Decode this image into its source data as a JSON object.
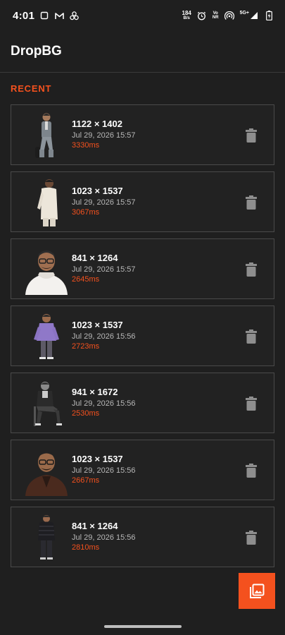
{
  "status_bar": {
    "time": "4:01",
    "icons_left": [
      "screen-icon",
      "gmail-icon",
      "apps-icon"
    ],
    "data_rate": "184",
    "data_unit": "B/s",
    "volte_line1": "Vo",
    "volte_line2": "NR",
    "network": "5G+"
  },
  "app": {
    "title": "DropBG"
  },
  "section": {
    "label": "RECENT"
  },
  "items": [
    {
      "dims": "1122 × 1402",
      "date": "Jul 29, 2026  15:57",
      "duration": "3330ms"
    },
    {
      "dims": "1023 × 1537",
      "date": "Jul 29, 2026  15:57",
      "duration": "3067ms"
    },
    {
      "dims": "841 × 1264",
      "date": "Jul 29, 2026  15:57",
      "duration": "2645ms"
    },
    {
      "dims": "1023 × 1537",
      "date": "Jul 29, 2026  15:56",
      "duration": "2723ms"
    },
    {
      "dims": "941 × 1672",
      "date": "Jul 29, 2026  15:56",
      "duration": "2530ms"
    },
    {
      "dims": "1023 × 1537",
      "date": "Jul 29, 2026  15:56",
      "duration": "2667ms"
    },
    {
      "dims": "841 × 1264",
      "date": "Jul 29, 2026  15:56",
      "duration": "2810ms"
    }
  ],
  "fab": {
    "icon": "photo-library-icon"
  },
  "colors": {
    "accent": "#f4511e",
    "background": "#1f1f1f",
    "card_border": "#4a4a4a"
  }
}
